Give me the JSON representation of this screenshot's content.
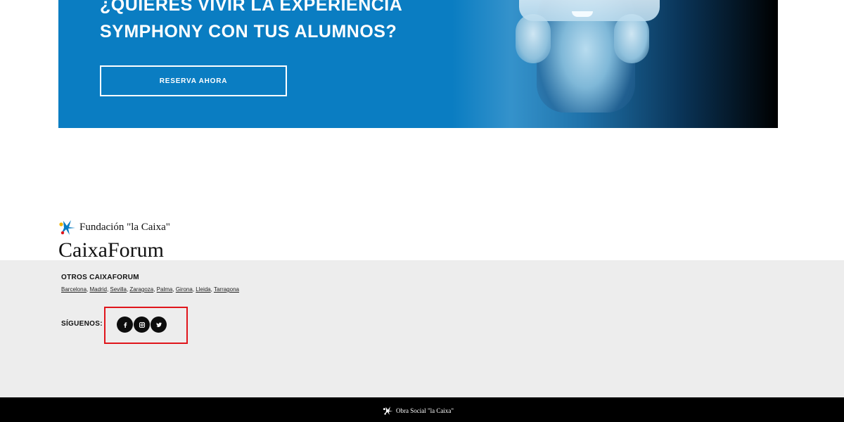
{
  "banner": {
    "title_line1": "¿QUIERES VIVIR LA EXPERIENCIA",
    "title_line2": "SYMPHONY CON TUS ALUMNOS?",
    "button_label": "RESERVA AHORA",
    "background_color": "#0a7dc2"
  },
  "logo": {
    "foundation": "Fundación \"la Caixa\"",
    "brand": "CaixaForum",
    "star_colors": [
      "#0a7dc2",
      "#e0151b",
      "#f2b400"
    ]
  },
  "footer": {
    "otros_title": "OTROS CAIXAFORUM",
    "cities": [
      "Barcelona",
      "Madrid",
      "Sevilla",
      "Zaragoza",
      "Palma",
      "Girona",
      "Lleida",
      "Tarragona"
    ],
    "siguenos_label": "SÍGUENOS:",
    "social": [
      "facebook-icon",
      "instagram-icon",
      "twitter-icon"
    ],
    "highlight_color": "#e0151b",
    "background_color": "#ededed"
  },
  "bottom_bar": {
    "text": "Obra Social \"la Caixa\""
  }
}
